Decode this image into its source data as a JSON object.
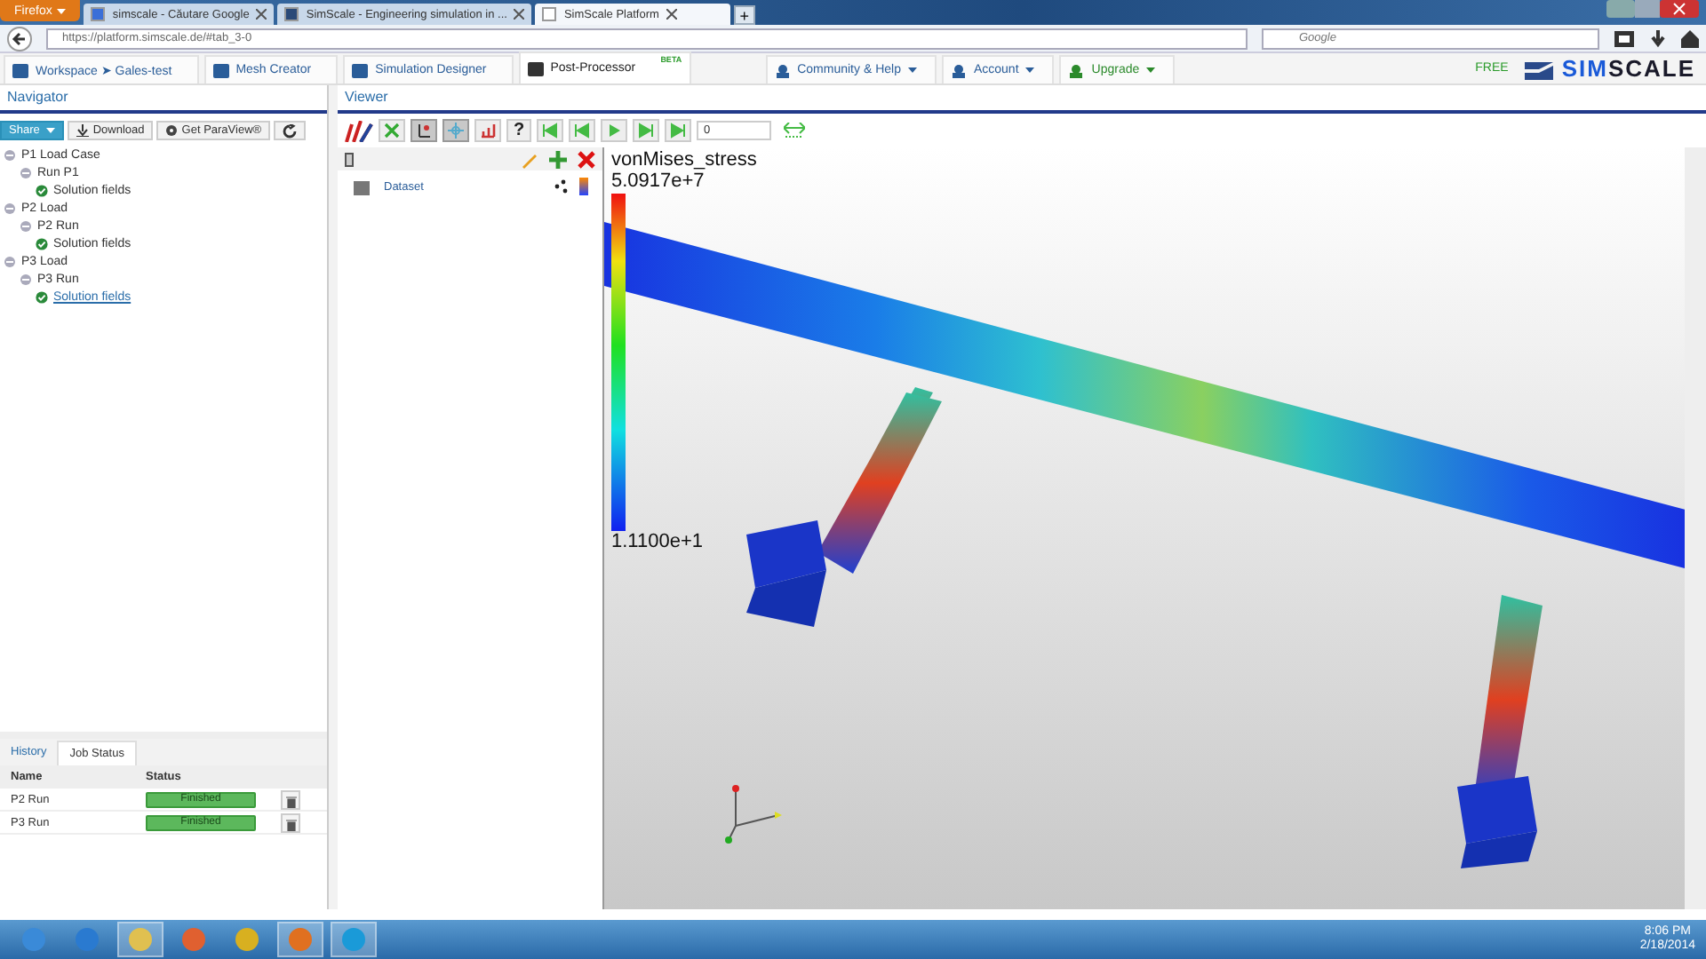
{
  "browser": {
    "app_button": "Firefox",
    "tabs": [
      {
        "title": "simscale - Căutare Google",
        "selected": false
      },
      {
        "title": "SimScale - Engineering simulation in ...",
        "selected": false
      },
      {
        "title": "SimScale Platform",
        "selected": true
      }
    ],
    "new_tab": "+",
    "url": "https://platform.simscale.de/#tab_3-0",
    "search_placeholder": "Google"
  },
  "app_nav": {
    "items": [
      {
        "label": "Workspace ➤ Gales-test",
        "selected": false
      },
      {
        "label": "Mesh Creator",
        "selected": false
      },
      {
        "label": "Simulation Designer",
        "selected": false
      },
      {
        "label": "Post-Processor",
        "selected": true,
        "badge": "BETA"
      }
    ],
    "menus": [
      {
        "label": "Community & Help",
        "kind": "plain"
      },
      {
        "label": "Account",
        "kind": "plain"
      },
      {
        "label": "Upgrade",
        "kind": "upgrade"
      }
    ],
    "plan": "FREE",
    "logo_prefix": "SIM",
    "logo_suffix": "SCALE"
  },
  "navigator": {
    "title": "Navigator",
    "buttons": [
      {
        "label": "Share",
        "kind": "primary"
      },
      {
        "label": "Download",
        "kind": "download"
      },
      {
        "label": "Get ParaView®",
        "kind": "paraview"
      },
      {
        "kind": "refresh"
      }
    ],
    "tree": [
      {
        "label": "P1 Load Case",
        "children": [
          {
            "label": "Run P1",
            "children": [
              {
                "label": "Solution fields",
                "selected": false
              }
            ]
          }
        ]
      },
      {
        "label": "P2 Load",
        "children": [
          {
            "label": "P2 Run",
            "children": [
              {
                "label": "Solution fields",
                "selected": false
              }
            ]
          }
        ]
      },
      {
        "label": "P3 Load",
        "children": [
          {
            "label": "P3 Run",
            "children": [
              {
                "label": "Solution fields",
                "selected": true
              }
            ]
          }
        ]
      }
    ]
  },
  "jobs": {
    "tabs": [
      {
        "label": "History",
        "selected": false
      },
      {
        "label": "Job Status",
        "selected": true
      }
    ],
    "columns": [
      "Name",
      "Status"
    ],
    "rows": [
      {
        "name": "P2 Run",
        "status": "Finished",
        "level": 1
      },
      {
        "name": "P3 Run",
        "status": "Finished",
        "level": 1
      }
    ]
  },
  "viewer": {
    "title": "Viewer",
    "tools": [
      {
        "kind": "fit",
        "pressed": false
      },
      {
        "kind": "axes",
        "pressed": true
      },
      {
        "kind": "center",
        "pressed": true
      },
      {
        "kind": "chart",
        "pressed": false
      },
      {
        "kind": "help",
        "pressed": false,
        "label": "?"
      }
    ],
    "frame": "0",
    "pipeline": [
      {
        "label": "Dataset"
      }
    ],
    "legend": {
      "title": "vonMises_stress",
      "max": "5.0917e+7",
      "min": "1.1100e+1"
    }
  },
  "taskbar": {
    "time": "8:06 PM",
    "date": "2/18/2014"
  }
}
